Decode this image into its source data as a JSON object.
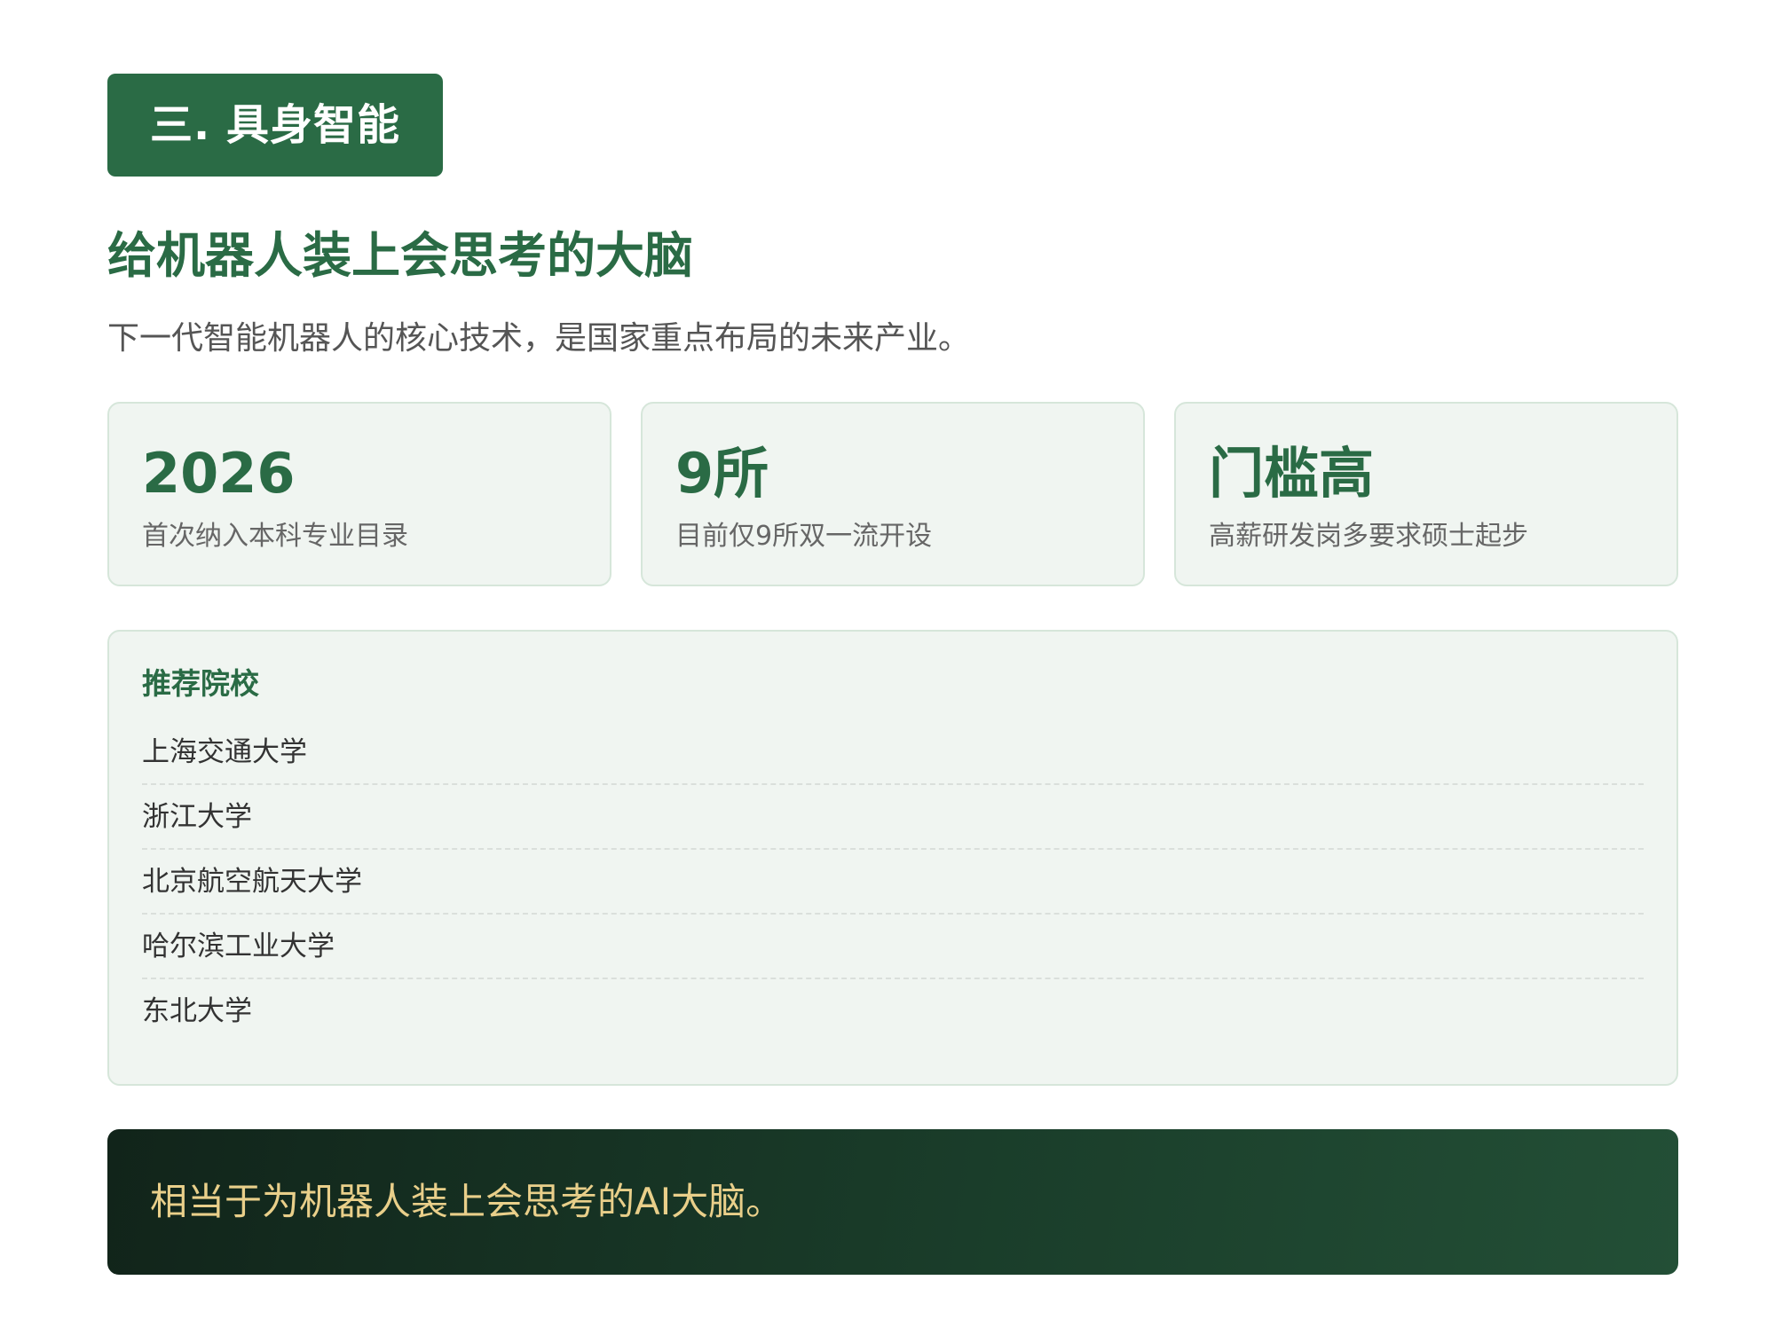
{
  "section": {
    "badge": "三. 具身智能",
    "headline": "给机器人装上会思考的大脑",
    "subline": "下一代智能机器人的核心技术，是国家重点布局的未来产业。"
  },
  "stats": [
    {
      "value": "2026",
      "desc": "首次纳入本科专业目录"
    },
    {
      "value": "9所",
      "desc": "目前仅9所双一流开设"
    },
    {
      "value": "门槛高",
      "desc": "高薪研发岗多要求硕士起步"
    }
  ],
  "schools": {
    "title": "推荐院校",
    "items": [
      "上海交通大学",
      "浙江大学",
      "北京航空航天大学",
      "哈尔滨工业大学",
      "东北大学"
    ]
  },
  "banner": {
    "text": "相当于为机器人装上会思考的AI大脑。"
  },
  "colors": {
    "accent": "#2a6b45",
    "card_bg": "#f0f5f1",
    "banner_text": "#e9cf8a"
  }
}
